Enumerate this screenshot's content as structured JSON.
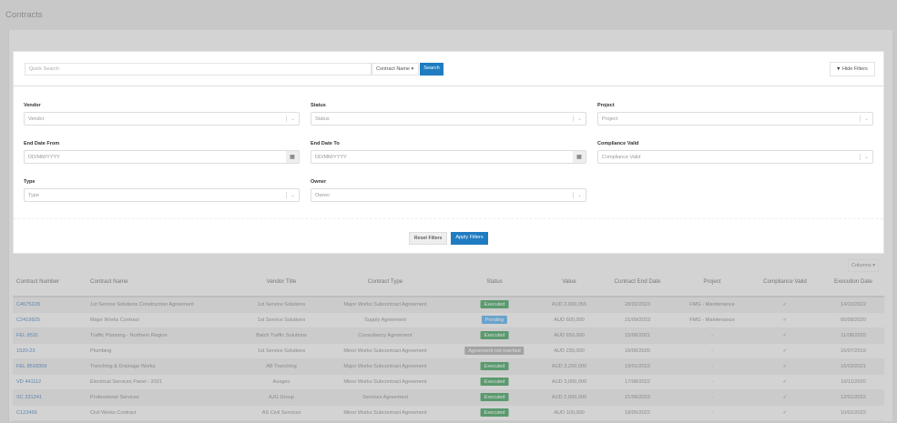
{
  "page": {
    "title": "Contracts"
  },
  "search": {
    "placeholder": "Quick Search",
    "field_selector": "Contract Name ▾",
    "search_label": "Search",
    "hide_filters_label": "Hide Filters"
  },
  "filters": [
    {
      "label": "Vendor",
      "placeholder": "Vendor",
      "kind": "select"
    },
    {
      "label": "Status",
      "placeholder": "Status",
      "kind": "select"
    },
    {
      "label": "Project",
      "placeholder": "Project",
      "kind": "select"
    },
    {
      "label": "End Date From",
      "placeholder": "DD/MM/YYYY",
      "kind": "date"
    },
    {
      "label": "End Date To",
      "placeholder": "DD/MM/YYYY",
      "kind": "date"
    },
    {
      "label": "Compliance Valid",
      "placeholder": "Compliance Valid",
      "kind": "select"
    },
    {
      "label": "Type",
      "placeholder": "Type",
      "kind": "select"
    },
    {
      "label": "Owner",
      "placeholder": "Owner",
      "kind": "select"
    }
  ],
  "actions": {
    "reset": "Reset Filters",
    "apply": "Apply Filters",
    "columns": "Columns ▾"
  },
  "table": {
    "headers": [
      "Contract Number",
      "Contract Name",
      "Vendor Title",
      "Contract Type",
      "Status",
      "Value",
      "Contract End Date",
      "Project",
      "Compliance Valid",
      "Execution Date"
    ],
    "rows": [
      [
        "C4675228",
        "1st Service Solutions Construction Agreement",
        "1st Service Solutions",
        "Major Works Subcontract Agreement",
        "Executed",
        "AUD 2,000,055",
        "28/02/2023",
        "FMG - Maintenance",
        "✓",
        "14/10/2022"
      ],
      [
        "C2419925",
        "Major Works Contract",
        "1st Service Solutions",
        "Supply Agreement",
        "Pending",
        "AUD 600,000",
        "21/09/2023",
        "FMG - Maintenance",
        "✓",
        "05/08/2020"
      ],
      [
        "FEL 8531",
        "Traffic Planning - Northern Region",
        "Batch Traffic Solutions",
        "Consultancy Agreement",
        "Executed",
        "AUD 650,000",
        "15/06/2021",
        "-",
        "✓",
        "11/08/2020"
      ],
      [
        "1520-23",
        "Plumbing",
        "1st Service Solutions",
        "Minor Works Subcontract Agreement",
        "Agreement not reached",
        "AUD 230,000",
        "16/06/2020",
        "-",
        "✓",
        "16/07/2019"
      ],
      [
        "FEL 8518359",
        "Trenching & Drainage Works",
        "AB Trenching",
        "Major Works Subcontract Agreement",
        "Executed",
        "AUD 3,200,000",
        "19/01/2023",
        "-",
        "✓",
        "16/03/2021"
      ],
      [
        "VD 441112",
        "Electrical Services Panel - 2021",
        "Ausgeo",
        "Minor Works Subcontract Agreement",
        "Executed",
        "AUD 3,000,000",
        "17/08/2022",
        "-",
        "✓",
        "10/11/2020"
      ],
      [
        "SC 231241",
        "Professional Services",
        "AJG Group",
        "Services Agreement",
        "Executed",
        "AUD 2,000,000",
        "21/06/2023",
        "-",
        "✓",
        "12/01/2022"
      ],
      [
        "C123456",
        "Civil Works Contract",
        "AS Civil Services",
        "Minor Works Subcontract Agreement",
        "Executed",
        "AUD 100,000",
        "18/05/2022",
        "-",
        "✓",
        "10/01/2022"
      ]
    ]
  },
  "colors": {
    "primary": "#1f7cc0",
    "executed": "#5a9a6e",
    "pending": "#6aa3cc",
    "not_reached": "#a3a3a3"
  }
}
